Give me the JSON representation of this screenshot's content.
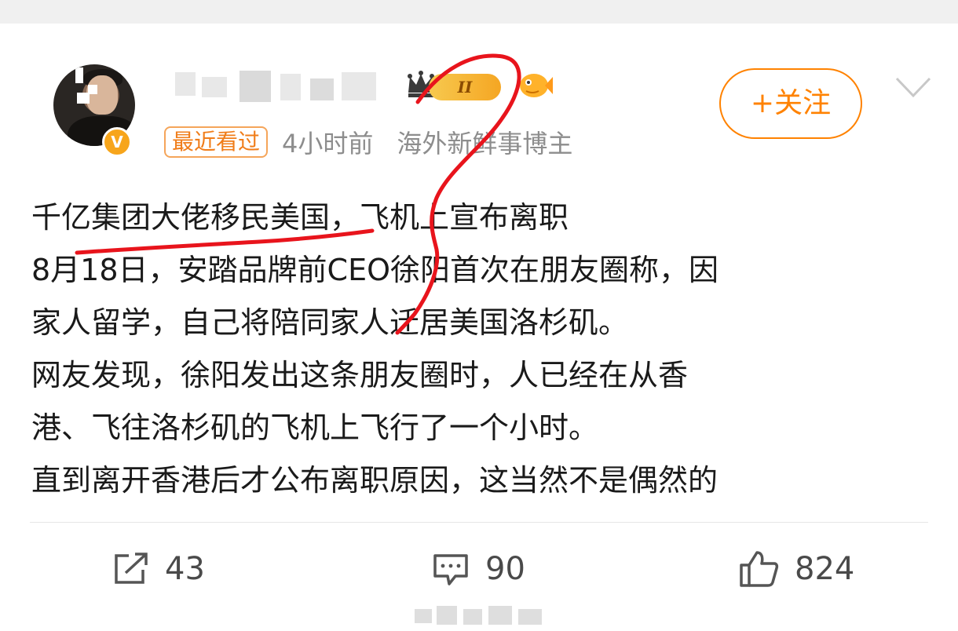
{
  "post": {
    "user": {
      "vip_level": "II",
      "recent_badge": "最近看过",
      "time": "4小时前",
      "description": "海外新鲜事博主",
      "verified_mark": "V"
    },
    "follow_label": "+关注",
    "lines": [
      "千亿集团大佬移民美国，飞机上宣布离职",
      "8月18日，安踏品牌前CEO徐阳首次在朋友圈称，因",
      "家人留学，自己将陪同家人迁居美国洛杉矶。",
      "网友发现，徐阳发出这条朋友圈时，人已经在从香",
      "港、飞往洛杉矶的飞机上飞行了一个小时。",
      "直到离开香港后才公布离职原因，这当然不是偶然的"
    ]
  },
  "actions": {
    "share_count": "43",
    "comment_count": "90",
    "like_count": "824"
  },
  "icons": [
    "crown-icon",
    "fish-icon",
    "chevron-down-icon",
    "share-icon",
    "comment-icon",
    "like-icon"
  ],
  "colors": {
    "accent": "#ff8200",
    "annotation": "#e8141c",
    "meta_text": "#8d8d8d"
  }
}
